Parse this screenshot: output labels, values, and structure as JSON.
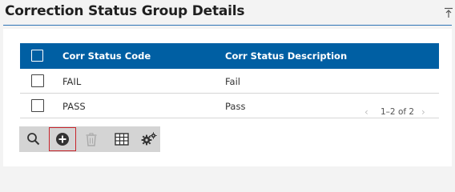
{
  "header": {
    "title": "Correction Status Group Details"
  },
  "grid": {
    "columns": [
      "Corr Status Code",
      "Corr Status Description"
    ],
    "rows": [
      {
        "code": "FAIL",
        "description": "Fail"
      },
      {
        "code": "PASS",
        "description": "Pass"
      }
    ]
  },
  "toolbar": {
    "buttons": [
      {
        "icon": "search-icon",
        "enabled": true
      },
      {
        "icon": "add-circle-icon",
        "enabled": true,
        "active": true
      },
      {
        "icon": "trash-icon",
        "enabled": false
      },
      {
        "icon": "columns-icon",
        "enabled": true
      },
      {
        "icon": "settings-icon",
        "enabled": true
      }
    ]
  },
  "pager": {
    "text": "1–2 of 2",
    "prev": "‹",
    "next": "›"
  },
  "colors": {
    "header": "#005fa3",
    "accent_border": "#c8242b",
    "title_rule": "#2f74b5"
  }
}
